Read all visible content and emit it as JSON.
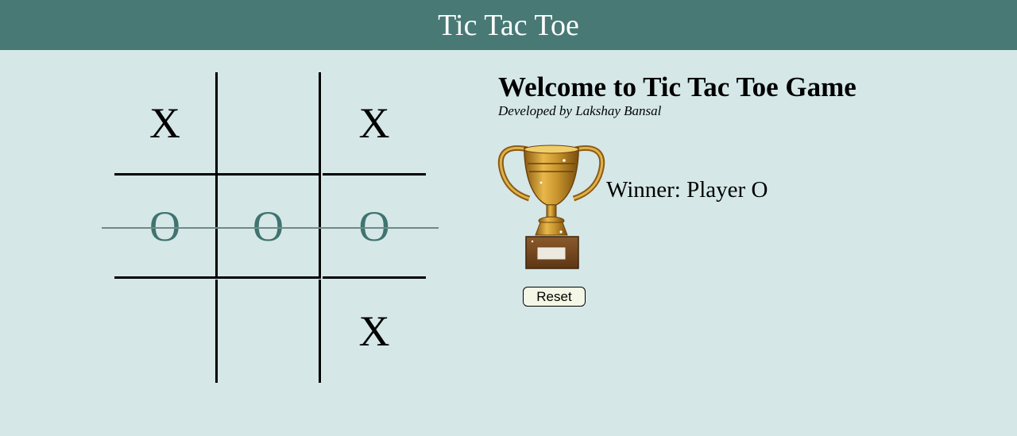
{
  "header": {
    "title": "Tic Tac Toe"
  },
  "board": {
    "cells": [
      "X",
      "",
      "X",
      "O",
      "O",
      "O",
      "",
      "",
      "X"
    ],
    "winning_row": 1
  },
  "info": {
    "heading": "Welcome to Tic Tac Toe Game",
    "subtitle": "Developed by Lakshay Bansal",
    "winner_text": "Winner: Player O",
    "trophy_icon": "trophy-icon"
  },
  "controls": {
    "reset_label": "Reset"
  },
  "colors": {
    "header_bg": "#487975",
    "page_bg": "#d5e7e7",
    "x_color": "#000000",
    "o_color": "#3f7370",
    "trophy_gold": "#c9952e"
  }
}
